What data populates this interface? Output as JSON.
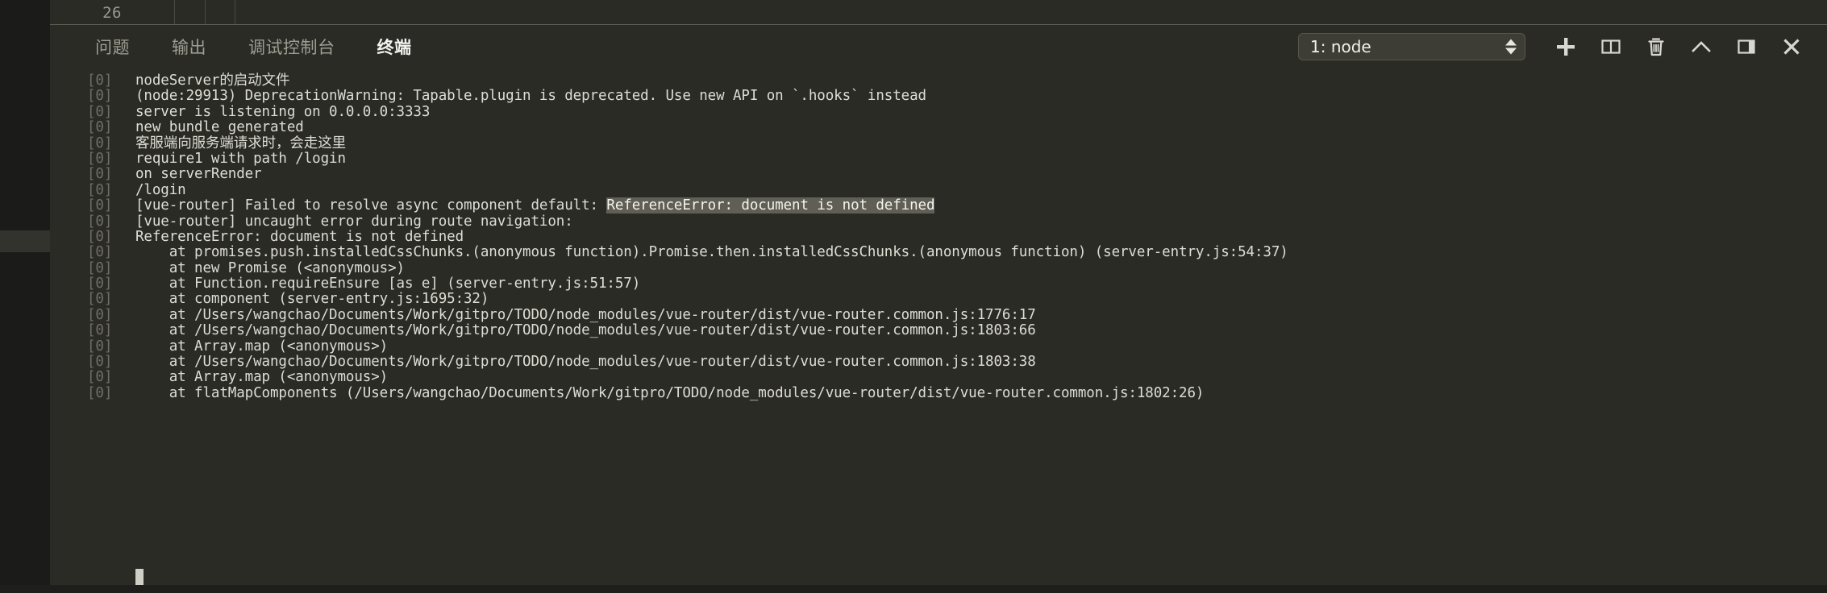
{
  "editor": {
    "line_number": "26"
  },
  "panel": {
    "tabs": [
      {
        "label": "问题",
        "name": "tab-problems",
        "active": false
      },
      {
        "label": "输出",
        "name": "tab-output",
        "active": false
      },
      {
        "label": "调试控制台",
        "name": "tab-debug-console",
        "active": false
      },
      {
        "label": "终端",
        "name": "tab-terminal",
        "active": true
      }
    ],
    "terminal_select": {
      "value": "1: node"
    },
    "actions": [
      {
        "name": "new-terminal-button",
        "icon": "plus-icon",
        "title": "新建终端"
      },
      {
        "name": "split-terminal-button",
        "icon": "split-panel-icon",
        "title": "拆分终端"
      },
      {
        "name": "kill-terminal-button",
        "icon": "trash-icon",
        "title": "终止终端"
      },
      {
        "name": "maximize-panel-button",
        "icon": "chevron-up-icon",
        "title": "最大化面板大小"
      },
      {
        "name": "toggle-panel-position-button",
        "icon": "panel-layout-icon",
        "title": "切换面板位置"
      },
      {
        "name": "close-panel-button",
        "icon": "close-x-icon",
        "title": "关闭面板"
      }
    ]
  },
  "terminal": {
    "prefix": "[0]",
    "lines": [
      {
        "text": "nodeServer的启动文件"
      },
      {
        "text": "(node:29913) DeprecationWarning: Tapable.plugin is deprecated. Use new API on `.hooks` instead"
      },
      {
        "text": "server is listening on 0.0.0.0:3333"
      },
      {
        "text": "new bundle generated"
      },
      {
        "text": "客服端向服务端请求时，会走这里"
      },
      {
        "text": "require1 with path /login"
      },
      {
        "text": "on serverRender"
      },
      {
        "text": "/login"
      },
      {
        "pre": "[vue-router] Failed to resolve async component default: ",
        "selected": "ReferenceError: document is not defined",
        "post": ""
      },
      {
        "text": "[vue-router] uncaught error during route navigation:"
      },
      {
        "text": "ReferenceError: document is not defined"
      },
      {
        "text": "    at promises.push.installedCssChunks.(anonymous function).Promise.then.installedCssChunks.(anonymous function) (server-entry.js:54:37)"
      },
      {
        "text": "    at new Promise (<anonymous>)"
      },
      {
        "text": "    at Function.requireEnsure [as e] (server-entry.js:51:57)"
      },
      {
        "text": "    at component (server-entry.js:1695:32)"
      },
      {
        "text": "    at /Users/wangchao/Documents/Work/gitpro/TODO/node_modules/vue-router/dist/vue-router.common.js:1776:17"
      },
      {
        "text": "    at /Users/wangchao/Documents/Work/gitpro/TODO/node_modules/vue-router/dist/vue-router.common.js:1803:66"
      },
      {
        "text": "    at Array.map (<anonymous>)"
      },
      {
        "text": "    at /Users/wangchao/Documents/Work/gitpro/TODO/node_modules/vue-router/dist/vue-router.common.js:1803:38"
      },
      {
        "text": "    at Array.map (<anonymous>)"
      },
      {
        "text": "    at flatMapComponents (/Users/wangchao/Documents/Work/gitpro/TODO/node_modules/vue-router/dist/vue-router.common.js:1802:26)"
      }
    ]
  },
  "colors": {
    "panel_bg": "#2b2b26",
    "rail_bg": "#1b1b19",
    "text": "#ddddd4",
    "dim_text": "#6f6f66",
    "active_tab": "#f2f2ee",
    "inactive_tab": "#9d9d92",
    "selection": "#5f5f56"
  }
}
